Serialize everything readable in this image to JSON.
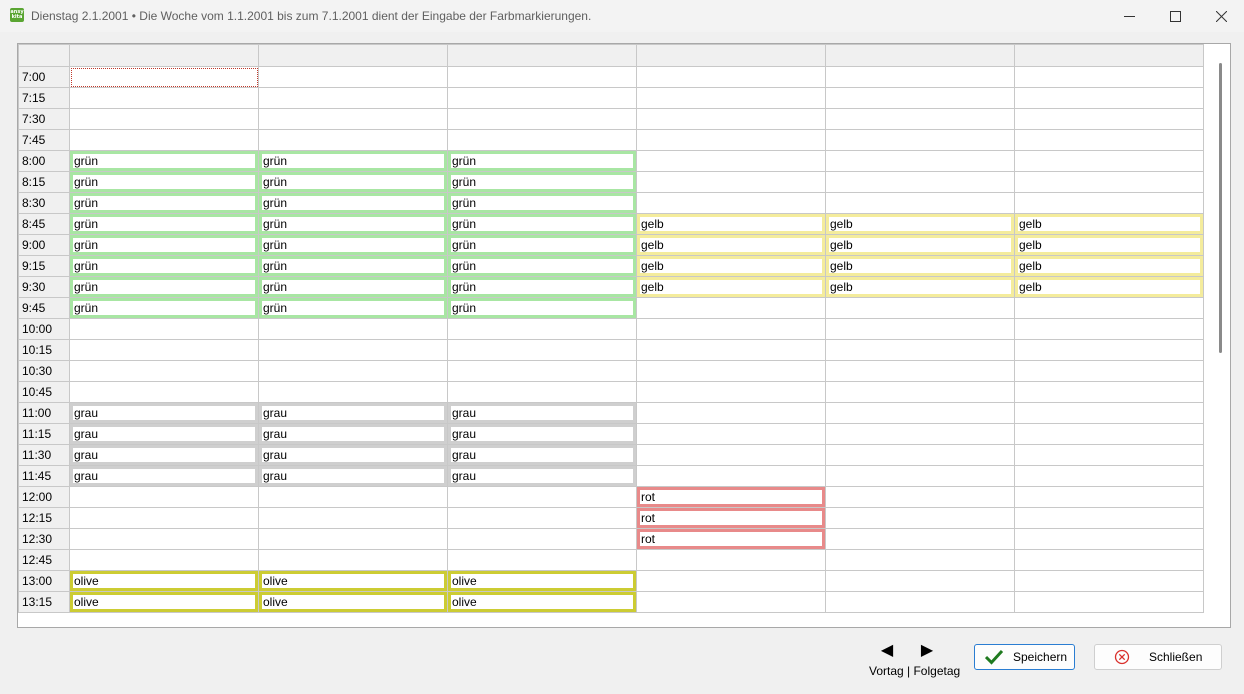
{
  "window": {
    "title": "Dienstag 2.1.2001 •   Die Woche vom 1.1.2001 bis zum 7.1.2001 dient der Eingabe der Farbmarkierungen.",
    "app_icon_text": "ansy kita",
    "controls": {
      "minimize": "minimize-icon",
      "maximize": "maximize-icon",
      "close": "close-icon"
    }
  },
  "grid": {
    "columns": [
      "",
      "",
      "",
      "",
      "",
      ""
    ],
    "times": [
      "7:00",
      "7:15",
      "7:30",
      "7:45",
      "8:00",
      "8:15",
      "8:30",
      "8:45",
      "9:00",
      "9:15",
      "9:30",
      "9:45",
      "10:00",
      "10:15",
      "10:30",
      "10:45",
      "11:00",
      "11:15",
      "11:30",
      "11:45",
      "12:00",
      "12:15",
      "12:30",
      "12:45",
      "13:00",
      "13:15"
    ],
    "selected_cell": {
      "row": 0,
      "col": 0
    },
    "colors": {
      "grün": "#a8e6a3",
      "gelb": "#f4ec9c",
      "grau": "#cfcfcf",
      "rot": "#e88a8a",
      "olive": "#cccc33"
    },
    "marks": [
      {
        "label": "grün",
        "rows": [
          4,
          11
        ],
        "cols": [
          0,
          2
        ]
      },
      {
        "label": "gelb",
        "rows": [
          7,
          10
        ],
        "cols": [
          3,
          5
        ]
      },
      {
        "label": "grau",
        "rows": [
          16,
          19
        ],
        "cols": [
          0,
          2
        ]
      },
      {
        "label": "rot",
        "rows": [
          20,
          22
        ],
        "cols": [
          3,
          3
        ]
      },
      {
        "label": "olive",
        "rows": [
          24,
          25
        ],
        "cols": [
          0,
          2
        ]
      }
    ]
  },
  "nav": {
    "prev_icon": "arrow-left-icon",
    "next_icon": "arrow-right-icon",
    "label": "Vortag | Folgetag"
  },
  "buttons": {
    "save_label": "Speichern",
    "close_label": "Schließen"
  }
}
